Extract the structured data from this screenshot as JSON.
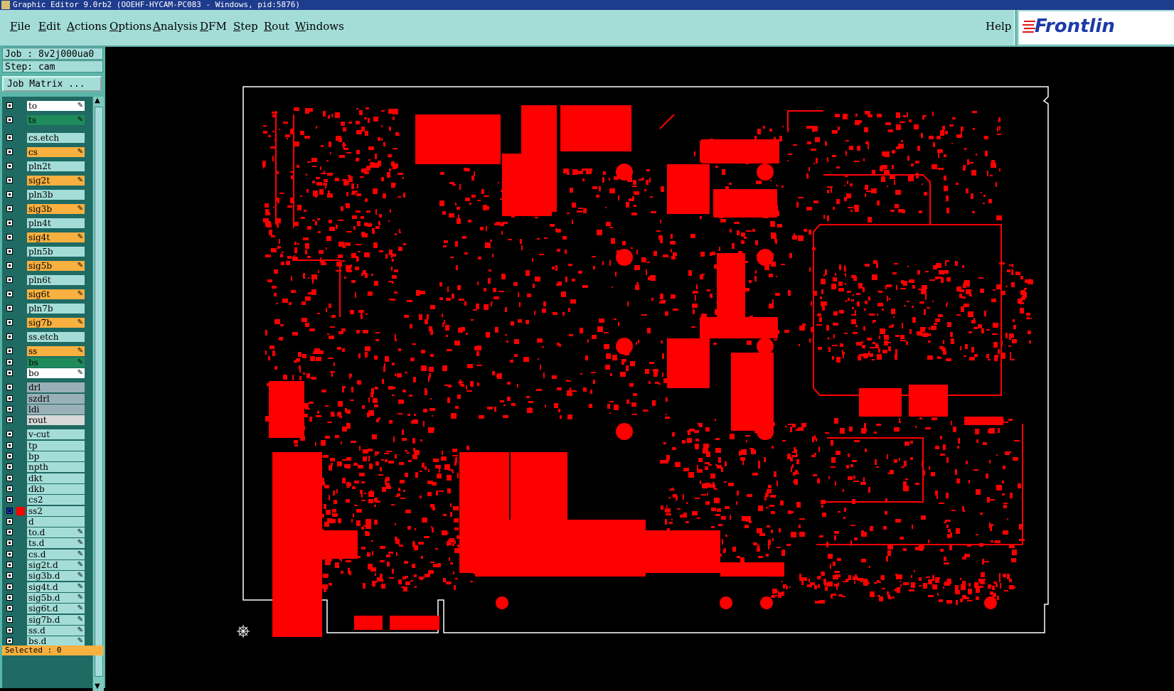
{
  "titlebar": {
    "text": "Graphic Editor 9.0rb2 (OOEHF-HYCAM-PC083 - Windows, pid:5876)"
  },
  "menu": {
    "items": [
      {
        "label": "File",
        "key": "F"
      },
      {
        "label": "Edit",
        "key": "E"
      },
      {
        "label": "Actions",
        "key": "A"
      },
      {
        "label": "Options",
        "key": "O"
      },
      {
        "label": "Analysis",
        "key": "A"
      },
      {
        "label": "DFM",
        "key": "D"
      },
      {
        "label": "Step",
        "key": "S"
      },
      {
        "label": "Rout",
        "key": "R"
      },
      {
        "label": "Windows",
        "key": "W"
      }
    ],
    "help": "Help"
  },
  "logo": {
    "text": "Frontlin"
  },
  "job": {
    "label": "Job : 8v2j000ua0"
  },
  "step": {
    "label": "Step: cam"
  },
  "job_matrix": {
    "label": "Job Matrix ..."
  },
  "layers": [
    {
      "name": "to",
      "color": "#ffffff",
      "edit": true
    },
    {
      "name": "ts",
      "color": "#1f8a5a",
      "edit": true
    },
    {
      "name": "cs.etch",
      "color": "#a4ddd8",
      "edit": false
    },
    {
      "name": "cs",
      "color": "#f8b040",
      "edit": true
    },
    {
      "name": "pln2t",
      "color": "#a4ddd8",
      "edit": false
    },
    {
      "name": "sig2t",
      "color": "#f8b040",
      "edit": true
    },
    {
      "name": "pln3b",
      "color": "#a4ddd8",
      "edit": false
    },
    {
      "name": "sig3b",
      "color": "#f8b040",
      "edit": true
    },
    {
      "name": "pln4t",
      "color": "#a4ddd8",
      "edit": false
    },
    {
      "name": "sig4t",
      "color": "#f8b040",
      "edit": true
    },
    {
      "name": "pln5b",
      "color": "#a4ddd8",
      "edit": false
    },
    {
      "name": "sig5b",
      "color": "#f8b040",
      "edit": true
    },
    {
      "name": "pln6t",
      "color": "#a4ddd8",
      "edit": false
    },
    {
      "name": "sig6t",
      "color": "#f8b040",
      "edit": true
    },
    {
      "name": "pln7b",
      "color": "#a4ddd8",
      "edit": false
    },
    {
      "name": "sig7b",
      "color": "#f8b040",
      "edit": true
    },
    {
      "name": "ss.etch",
      "color": "#a4ddd8",
      "edit": false
    },
    {
      "name": "ss",
      "color": "#f8b040",
      "edit": true
    },
    {
      "name": "bs",
      "color": "#1f8a5a",
      "edit": true
    },
    {
      "name": "bo",
      "color": "#ffffff",
      "edit": true
    },
    {
      "name": "drl",
      "color": "#9ab0b8",
      "edit": false
    },
    {
      "name": "szdrl",
      "color": "#9ab0b8",
      "edit": false
    },
    {
      "name": "ldi",
      "color": "#9ab0b8",
      "edit": false
    },
    {
      "name": "rout",
      "color": "#d8d8d8",
      "edit": false
    },
    {
      "name": "v-cut",
      "color": "#a4ddd8",
      "edit": false
    },
    {
      "name": "tp",
      "color": "#a4ddd8",
      "edit": false
    },
    {
      "name": "bp",
      "color": "#a4ddd8",
      "edit": false
    },
    {
      "name": "npth",
      "color": "#a4ddd8",
      "edit": false
    },
    {
      "name": "dkt",
      "color": "#a4ddd8",
      "edit": false
    },
    {
      "name": "dkb",
      "color": "#a4ddd8",
      "edit": false
    },
    {
      "name": "cs2",
      "color": "#a4ddd8",
      "edit": false
    },
    {
      "name": "ss2",
      "color": "#a4ddd8",
      "edit": false,
      "active": true
    },
    {
      "name": "d",
      "color": "#a4ddd8",
      "edit": false
    },
    {
      "name": "to.d",
      "color": "#a4ddd8",
      "edit": true
    },
    {
      "name": "ts.d",
      "color": "#a4ddd8",
      "edit": true
    },
    {
      "name": "cs.d",
      "color": "#a4ddd8",
      "edit": true
    },
    {
      "name": "sig2t.d",
      "color": "#a4ddd8",
      "edit": true
    },
    {
      "name": "sig3b.d",
      "color": "#a4ddd8",
      "edit": true
    },
    {
      "name": "sig4t.d",
      "color": "#a4ddd8",
      "edit": true
    },
    {
      "name": "sig5b.d",
      "color": "#a4ddd8",
      "edit": true
    },
    {
      "name": "sig6t.d",
      "color": "#a4ddd8",
      "edit": true
    },
    {
      "name": "sig7b.d",
      "color": "#a4ddd8",
      "edit": true
    },
    {
      "name": "ss.d",
      "color": "#a4ddd8",
      "edit": true
    },
    {
      "name": "bs.d",
      "color": "#a4ddd8",
      "edit": true
    }
  ],
  "status": {
    "selected": "Selected : 0"
  },
  "colors": {
    "copper": "#ff0000",
    "panel": "#a4ddd8",
    "signal_layer": "#f8b040"
  }
}
